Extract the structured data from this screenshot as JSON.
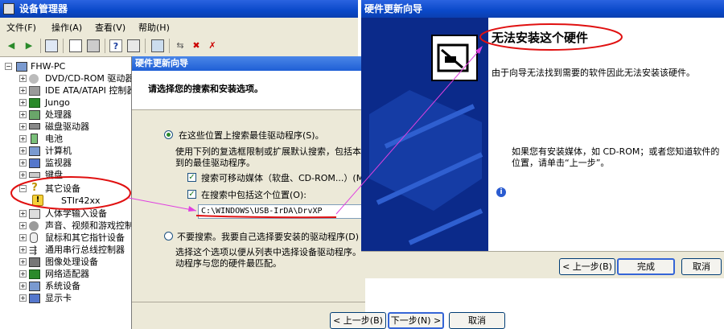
{
  "device_manager": {
    "title": "设备管理器",
    "menu": [
      "文件(F)",
      "操作(A)",
      "查看(V)",
      "帮助(H)"
    ],
    "tree": {
      "root": "FHW-PC",
      "items": [
        "DVD/CD-ROM 驱动器",
        "IDE ATA/ATAPI 控制器",
        "Jungo",
        "处理器",
        "磁盘驱动器",
        "电池",
        "计算机",
        "监视器",
        "键盘",
        "其它设备",
        "STIr42xx",
        "人体学输入设备",
        "声音、视频和游戏控制器",
        "鼠标和其它指针设备",
        "通用串行总线控制器",
        "图像处理设备",
        "网络适配器",
        "系统设备",
        "显示卡"
      ]
    }
  },
  "wizard_search": {
    "title": "硬件更新向导",
    "heading": "请选择您的搜索和安装选项。",
    "option_search": "在这些位置上搜索最佳驱动程序(S)。",
    "option_search_desc_1": "使用下列的复选框限制或扩展默认搜索，包括本",
    "option_search_desc_2": "到的最佳驱动程序。",
    "check_removable": "搜索可移动媒体（软盘、CD-ROM...）(M)",
    "check_include_location": "在搜索中包括这个位置(O):",
    "location_value": "C:\\WINDOWS\\USB-IrDA\\DrvXP",
    "option_manual": "不要搜索。我要自己选择要安装的驱动程序(D)",
    "option_manual_desc_1": "选择这个选项以便从列表中选择设备驱动程序。",
    "option_manual_desc_2": "动程序与您的硬件最匹配。",
    "btn_back": "< 上一步(B)",
    "btn_next": "下一步(N) >",
    "btn_cancel": "取消"
  },
  "wizard_fail": {
    "title": "硬件更新向导",
    "heading": "无法安装这个硬件",
    "message": "由于向导无法找到需要的软件因此无法安装该硬件。",
    "hint_1": "如果您有安装媒体，如 CD-ROM；或者您知道软件的",
    "hint_2": "位置，请单击“上一步”。",
    "btn_back": "< 上一步(B)",
    "btn_finish": "完成",
    "btn_cancel": "取消"
  },
  "colors": {
    "annotation_red": "#e01010",
    "annotation_arrow": "#e040e0",
    "xp_title_blue": "#0a49c9",
    "dialog_face": "#ece9d8"
  }
}
